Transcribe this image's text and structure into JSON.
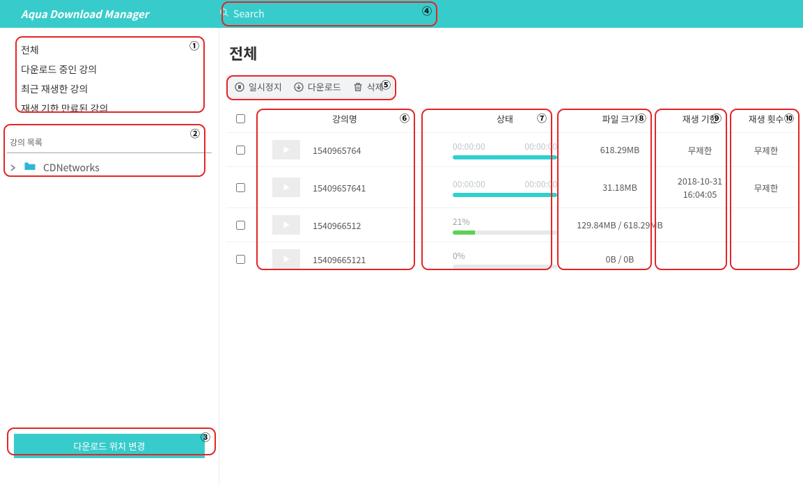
{
  "brand": "Aqua Download Manager",
  "search": {
    "placeholder": "Search"
  },
  "sidebar": {
    "filters": [
      {
        "label": "전체"
      },
      {
        "label": "다운로드 중인 강의"
      },
      {
        "label": "최근 재생한 강의"
      },
      {
        "label": "재생 기한 만료된 강의"
      }
    ],
    "catalog_title": "강의 목록",
    "tree": [
      {
        "label": "CDNetworks"
      }
    ],
    "change_location": "다운로드 위치 변경"
  },
  "page": {
    "title": "전체"
  },
  "toolbar": {
    "pause": "일시정지",
    "download": "다운로드",
    "delete": "삭제"
  },
  "columns": {
    "name": "강의명",
    "status": "상태",
    "size": "파일 크기",
    "expire": "재생 기한",
    "plays": "재생 횟수"
  },
  "rows": [
    {
      "name": "1540965764",
      "status_type": "full",
      "time_a": "00:00:00",
      "time_b": "00:00:00",
      "pct": 100,
      "size": "618.29MB",
      "expire": "무제한",
      "plays": "무제한"
    },
    {
      "name": "15409657641",
      "status_type": "full",
      "time_a": "00:00:00",
      "time_b": "00:00:00",
      "pct": 100,
      "size": "31.18MB",
      "expire": "2018-10-31 16:04:05",
      "plays": "무제한"
    },
    {
      "name": "1540966512",
      "status_type": "pct",
      "pct_label": "21%",
      "pct": 21,
      "size": "129.84MB / 618.29MB",
      "expire": "",
      "plays": ""
    },
    {
      "name": "15409665121",
      "status_type": "pct",
      "pct_label": "0%",
      "pct": 0,
      "size": "0B / 0B",
      "expire": "",
      "plays": ""
    }
  ],
  "annotations": {
    "1": "①",
    "2": "②",
    "3": "③",
    "4": "④",
    "5": "⑤",
    "6": "⑥",
    "7": "⑦",
    "8": "⑧",
    "9": "⑨",
    "10": "⑩"
  }
}
